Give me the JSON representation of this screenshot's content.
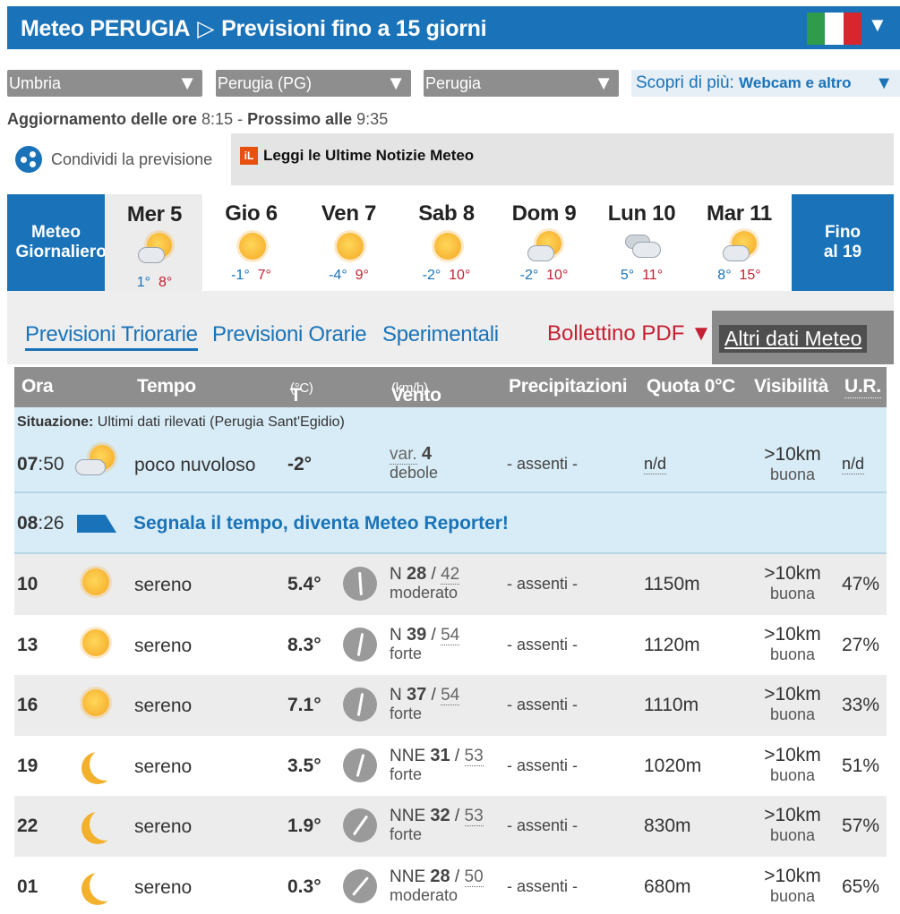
{
  "header": {
    "title_city": "Meteo PERUGIA",
    "title_sub": "Previsioni fino a 15 giorni",
    "flag_icon": "italy-flag-icon"
  },
  "selects": [
    {
      "value": "Umbria"
    },
    {
      "value": "Perugia (PG)"
    },
    {
      "value": "Perugia"
    }
  ],
  "discover": {
    "label": "Scopri di più:",
    "link": "Webcam e altro"
  },
  "update": {
    "label": "Aggiornamento delle ore",
    "time": "8:15",
    "next_label": "Prossimo alle",
    "next_time": "9:35"
  },
  "share": {
    "label": "Condividi la previsione"
  },
  "news": {
    "label": "Leggi le Ultime Notizie Meteo",
    "logo": "iL"
  },
  "days_strip": {
    "left_tile": "Meteo Giornaliero",
    "right_tile": "Fino al 19",
    "days": [
      {
        "name": "Mer 5",
        "icon": "partly-cloudy-icon",
        "min": "1°",
        "max": "8°"
      },
      {
        "name": "Gio 6",
        "icon": "sun-icon",
        "min": "-1°",
        "max": "7°"
      },
      {
        "name": "Ven 7",
        "icon": "sun-icon",
        "min": "-4°",
        "max": "9°"
      },
      {
        "name": "Sab 8",
        "icon": "sun-icon",
        "min": "-2°",
        "max": "10°"
      },
      {
        "name": "Dom 9",
        "icon": "partly-cloudy-icon",
        "min": "-2°",
        "max": "10°"
      },
      {
        "name": "Lun 10",
        "icon": "cloudy-icon",
        "min": "5°",
        "max": "11°"
      },
      {
        "name": "Mar 11",
        "icon": "partly-cloudy-icon",
        "min": "8°",
        "max": "15°"
      }
    ]
  },
  "tabs": {
    "items": [
      "Previsioni Triorarie",
      "Previsioni Orarie",
      "Sperimentali"
    ],
    "pdf": "Bollettino PDF",
    "other": "Altri dati Meteo"
  },
  "table": {
    "headers": {
      "ora": "Ora",
      "tempo": "Tempo",
      "t": "T",
      "t_unit": "(°C)",
      "vento": "Vento",
      "vento_unit": "(km/h)",
      "prec": "Precipitazioni",
      "quota": "Quota 0°C",
      "vis": "Visibilità",
      "ur": "U.R."
    },
    "situation": {
      "label": "Situazione:",
      "text": "Ultimi dati rilevati (Perugia Sant'Egidio)",
      "time_h": "07",
      "time_m": ":50",
      "tempo": "poco nuvoloso",
      "t": "-2°",
      "wind_dir": "var.",
      "wind_speed": "4",
      "wind_desc": "debole",
      "prec": "- assenti -",
      "quota": "n/d",
      "vis": ">10km",
      "vis_desc": "buona",
      "ur": "n/d"
    },
    "reporter": {
      "time_h": "08",
      "time_m": ":26",
      "text": "Segnala il tempo, diventa Meteo Reporter!"
    },
    "rows": [
      {
        "ora": "10",
        "icon": "sun-icon",
        "tempo": "sereno",
        "t": "5.4°",
        "dir": "N",
        "speed": "28",
        "gust": "42",
        "wdesc": "moderato",
        "prec": "- assenti -",
        "quota": "1150m",
        "vis": ">10km",
        "vdesc": "buona",
        "ur": "47%"
      },
      {
        "ora": "13",
        "icon": "sun-icon",
        "tempo": "sereno",
        "t": "8.3°",
        "dir": "N",
        "speed": "39",
        "gust": "54",
        "wdesc": "forte",
        "prec": "- assenti -",
        "quota": "1120m",
        "vis": ">10km",
        "vdesc": "buona",
        "ur": "27%"
      },
      {
        "ora": "16",
        "icon": "sun-icon",
        "tempo": "sereno",
        "t": "7.1°",
        "dir": "N",
        "speed": "37",
        "gust": "54",
        "wdesc": "forte",
        "prec": "- assenti -",
        "quota": "1110m",
        "vis": ">10km",
        "vdesc": "buona",
        "ur": "33%"
      },
      {
        "ora": "19",
        "icon": "moon-icon",
        "tempo": "sereno",
        "t": "3.5°",
        "dir": "NNE",
        "speed": "31",
        "gust": "53",
        "wdesc": "forte",
        "prec": "- assenti -",
        "quota": "1020m",
        "vis": ">10km",
        "vdesc": "buona",
        "ur": "51%"
      },
      {
        "ora": "22",
        "icon": "moon-icon",
        "tempo": "sereno",
        "t": "1.9°",
        "dir": "NNE",
        "speed": "32",
        "gust": "53",
        "wdesc": "forte",
        "prec": "- assenti -",
        "quota": "830m",
        "vis": ">10km",
        "vdesc": "buona",
        "ur": "57%"
      },
      {
        "ora": "01",
        "icon": "moon-icon",
        "tempo": "sereno",
        "t": "0.3°",
        "dir": "NNE",
        "speed": "28",
        "gust": "50",
        "wdesc": "moderato",
        "prec": "- assenti -",
        "quota": "680m",
        "vis": ">10km",
        "vdesc": "buona",
        "ur": "65%"
      }
    ]
  },
  "colors": {
    "brand": "#1a73b8",
    "max_temp": "#c41f32",
    "header_gray": "#8e8e8e"
  }
}
